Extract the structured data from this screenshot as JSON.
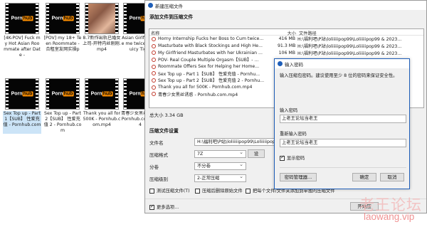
{
  "explorer": {
    "thumbnails": [
      {
        "caption": "[4K-POV] Fuck my Hot Asian Roommate after Date -",
        "kind": "logo",
        "logo_main": "Porn",
        "logo_hub": "hub"
      },
      {
        "caption": "[POV] my 18+ Teen Roommate - 合租室友网实操p",
        "kind": "logo",
        "logo_main": "Porn",
        "logo_hub": "hub"
      },
      {
        "caption": "8.7新作出轨已婚女上司-开特内丝刚刚.mp4",
        "kind": "photo"
      },
      {
        "caption": "Asian Girlfri made me twice with Juicy Tight",
        "kind": "logo",
        "logo_main": "Porn",
        "logo_hub": "hub"
      },
      {
        "caption": "Sex Top up - Part 1【SUB】 性爱充值 - Pornhub.com",
        "kind": "logo",
        "logo_main": "Porn",
        "logo_hub": "hub"
      },
      {
        "caption": "Sex Top up - Part 2【SUB】 性爱充值 2 - Pornhub.com",
        "kind": "logo",
        "logo_main": "Porn",
        "logo_hub": "hub"
      },
      {
        "caption": "Thank you all for 500K - Pornhub.com.mp4",
        "kind": "logo",
        "logo_main": "Porn",
        "logo_hub": "hub"
      },
      {
        "caption": "青春少女黑丝诱惑 - Pornhub.com.mp4",
        "kind": "logo",
        "logo_main": "Porn",
        "logo_hub": "hub"
      }
    ]
  },
  "main_dialog": {
    "title": "新建压缩文件",
    "section_title": "添加文件到压缩文件",
    "columns": {
      "name": "名称",
      "size": "大小",
      "path": "文件路径"
    },
    "files": [
      {
        "name": "Horny Internship Fucks her Boss to Cum twice...",
        "size": "416 MB",
        "path": "H:\\福利吧\\P站\\loliiiiipop99\\Loliiiiipop99 & 2023..."
      },
      {
        "name": "Masturbate with Black Stockings and High He...",
        "size": "91.3 MB",
        "path": "H:\\福利吧\\P站\\loliiiiipop99\\Loliiiiipop99 & 2023..."
      },
      {
        "name": "My Girlfriend Masturbates with her Ukrainian ...",
        "size": "106 MB",
        "path": "H:\\福利吧\\P站\\loliiiiipop99\\Loliiiiipop99 & 2023..."
      },
      {
        "name": "POV- Real Couple Multiple Orgasm【SUB】- ...",
        "size": "",
        "path": ""
      },
      {
        "name": "Roommate Offers Sex for Helping her Home...",
        "size": "",
        "path": ""
      },
      {
        "name": "Sex Top up - Part 1【SUB】 性爱充值 - Pornhu...",
        "size": "",
        "path": ""
      },
      {
        "name": "Sex Top up - Part 2【SUB】 性爱充值 2 - Pornhu...",
        "size": "",
        "path": ""
      },
      {
        "name": "Thank you all for 500K - Pornhub.com.mp4",
        "size": "",
        "path": ""
      },
      {
        "name": "青春少女黑丝诱惑 - Pornhub.com.mp4",
        "size": "",
        "path": ""
      }
    ],
    "total": "总大小 3.34 GB",
    "options_title": "压缩文件设置",
    "filename_label": "文件名",
    "filename_value": "H:\\福利吧\\P站\\loliiiiipop99\\Loliiiiipop99",
    "format_label": "压缩格式",
    "format_value": "7Z",
    "split_label": "分卷",
    "split_value": "不分卷",
    "level_label": "压缩级别",
    "level_value": "2-正常压缩",
    "settings_button": "设",
    "check_test": "测试压缩文件(T)",
    "check_delete": "压缩后删除原始文件",
    "check_each": "把每个文件/文件夹添加到单独的压缩文件",
    "check_more": "更多选项...",
    "start_button": "开始压"
  },
  "password_dialog": {
    "title": "输入密码",
    "description": "输入压缩包密码。建议使用至少 8 位的密码来保证安全性。",
    "password_label": "输入密码",
    "password_value": "上老王论坛当老王",
    "confirm_label": "重新输入密码",
    "confirm_value": "上老王论坛当老王",
    "show_password": "显示密码",
    "manager_button": "密码管理器...",
    "ok_button": "确定",
    "cancel_button": "取消"
  },
  "watermark": {
    "line1": "老王论坛",
    "line2": "laowang.vip"
  },
  "colors": {
    "accent": "#1e5eb8",
    "logo_orange": "#ff9000",
    "file_icon": "#c0392b",
    "watermark": "#ed8080"
  }
}
